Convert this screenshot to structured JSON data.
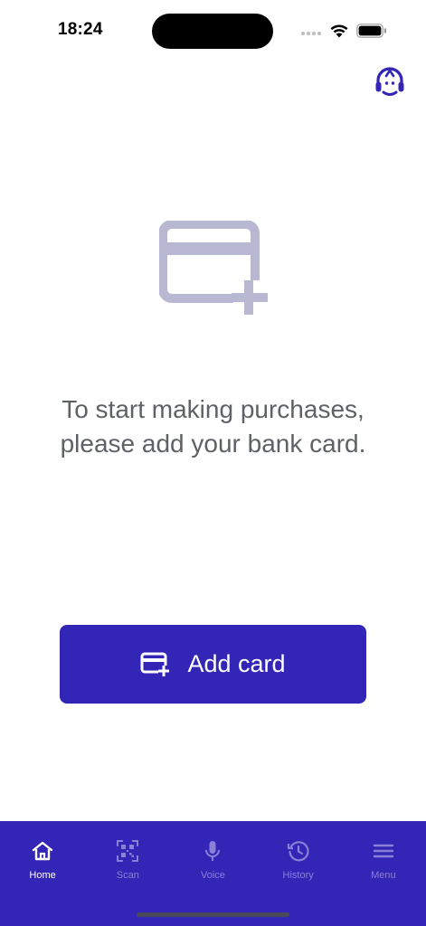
{
  "status_bar": {
    "time": "18:24"
  },
  "main": {
    "message": "To start making purchases, please add your bank card.",
    "add_card_label": "Add card"
  },
  "nav": {
    "items": [
      {
        "label": "Home",
        "icon": "home-icon",
        "active": true
      },
      {
        "label": "Scan",
        "icon": "qr-code-icon",
        "active": false
      },
      {
        "label": "Voice",
        "icon": "microphone-icon",
        "active": false
      },
      {
        "label": "History",
        "icon": "history-icon",
        "active": false
      },
      {
        "label": "Menu",
        "icon": "hamburger-menu-icon",
        "active": false
      }
    ]
  },
  "colors": {
    "primary": "#3325b5",
    "illustration": "#b9b8d2",
    "text_muted": "#5e6166",
    "nav_inactive": "#8a80d8"
  }
}
